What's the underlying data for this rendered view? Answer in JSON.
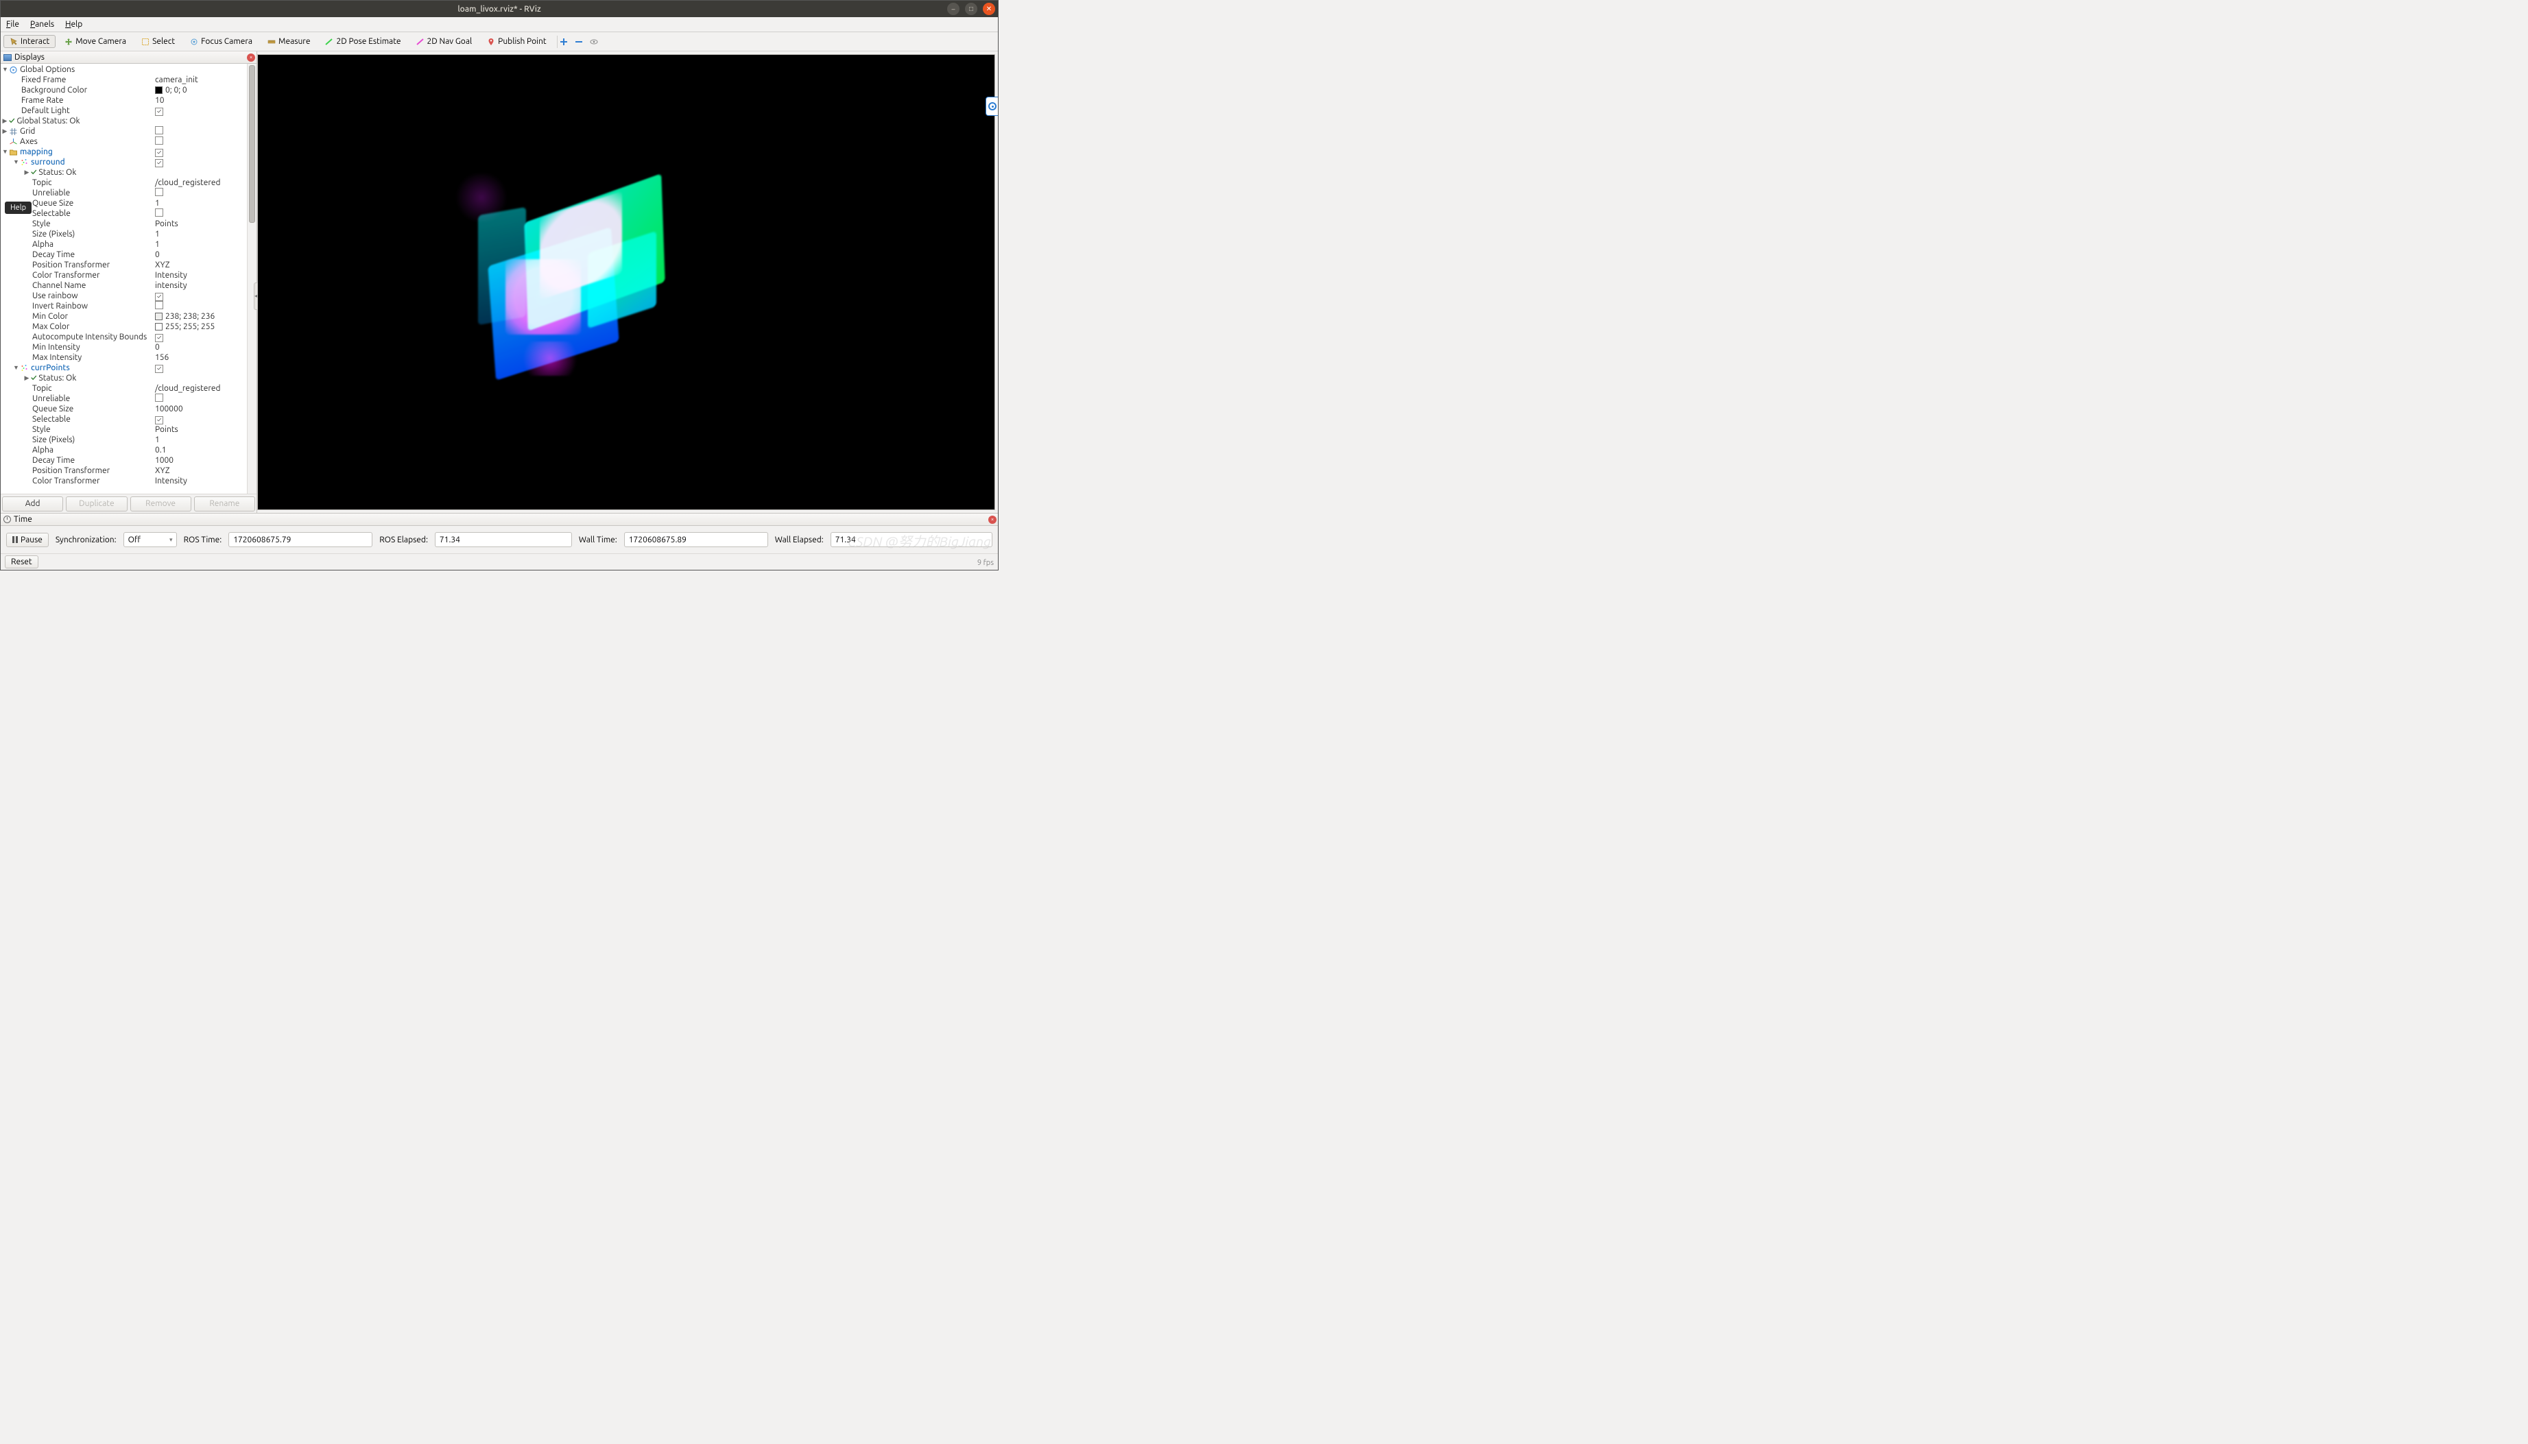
{
  "window": {
    "title": "loam_livox.rviz* - RViz",
    "help_tooltip": "Help"
  },
  "menubar": {
    "file": "File",
    "panels": "Panels",
    "help": "Help"
  },
  "toolbar": {
    "interact": "Interact",
    "move_camera": "Move Camera",
    "select": "Select",
    "focus_camera": "Focus Camera",
    "measure": "Measure",
    "pose_estimate": "2D Pose Estimate",
    "nav_goal": "2D Nav Goal",
    "publish_point": "Publish Point"
  },
  "displays": {
    "title": "Displays",
    "add": "Add",
    "duplicate": "Duplicate",
    "remove": "Remove",
    "rename": "Rename",
    "global_options": {
      "label": "Global Options",
      "fixed_frame": {
        "k": "Fixed Frame",
        "v": "camera_init"
      },
      "background_color": {
        "k": "Background Color",
        "v": "0; 0; 0"
      },
      "frame_rate": {
        "k": "Frame Rate",
        "v": "10"
      },
      "default_light": {
        "k": "Default Light",
        "v_on": true
      }
    },
    "global_status": {
      "k": "Global Status: Ok"
    },
    "grid": {
      "k": "Grid"
    },
    "axes": {
      "k": "Axes"
    },
    "mapping": {
      "label": "mapping",
      "surround": {
        "label": "surround",
        "status": "Status: Ok",
        "topic": {
          "k": "Topic",
          "v": "/cloud_registered"
        },
        "unreliable": {
          "k": "Unreliable",
          "v_on": false
        },
        "queue_size": {
          "k": "Queue Size",
          "v": "1"
        },
        "selectable": {
          "k": "Selectable",
          "v_on": false
        },
        "style": {
          "k": "Style",
          "v": "Points"
        },
        "size_pixels": {
          "k": "Size (Pixels)",
          "v": "1"
        },
        "alpha": {
          "k": "Alpha",
          "v": "1"
        },
        "decay_time": {
          "k": "Decay Time",
          "v": "0"
        },
        "pos_transformer": {
          "k": "Position Transformer",
          "v": "XYZ"
        },
        "color_transformer": {
          "k": "Color Transformer",
          "v": "Intensity"
        },
        "channel_name": {
          "k": "Channel Name",
          "v": "intensity"
        },
        "use_rainbow": {
          "k": "Use rainbow",
          "v_on": true
        },
        "invert_rainbow": {
          "k": "Invert Rainbow",
          "v_on": false
        },
        "min_color": {
          "k": "Min Color",
          "v": "238; 238; 236"
        },
        "max_color": {
          "k": "Max Color",
          "v": "255; 255; 255"
        },
        "autocompute": {
          "k": "Autocompute Intensity Bounds",
          "v_on": true
        },
        "min_intensity": {
          "k": "Min Intensity",
          "v": "0"
        },
        "max_intensity": {
          "k": "Max Intensity",
          "v": "156"
        }
      },
      "currpoints": {
        "label": "currPoints",
        "status": "Status: Ok",
        "topic": {
          "k": "Topic",
          "v": "/cloud_registered"
        },
        "unreliable": {
          "k": "Unreliable",
          "v_on": false
        },
        "queue_size": {
          "k": "Queue Size",
          "v": "100000"
        },
        "selectable": {
          "k": "Selectable",
          "v_on": true
        },
        "style": {
          "k": "Style",
          "v": "Points"
        },
        "size_pixels": {
          "k": "Size (Pixels)",
          "v": "1"
        },
        "alpha": {
          "k": "Alpha",
          "v": "0.1"
        },
        "decay_time": {
          "k": "Decay Time",
          "v": "1000"
        },
        "pos_transformer": {
          "k": "Position Transformer",
          "v": "XYZ"
        },
        "color_transformer": {
          "k": "Color Transformer",
          "v": "Intensity"
        }
      }
    }
  },
  "time": {
    "title": "Time",
    "pause": "Pause",
    "sync_label": "Synchronization:",
    "sync_value": "Off",
    "ros_time_label": "ROS Time:",
    "ros_time_value": "1720608675.79",
    "ros_elapsed_label": "ROS Elapsed:",
    "ros_elapsed_value": "71.34",
    "wall_time_label": "Wall Time:",
    "wall_time_value": "1720608675.89",
    "wall_elapsed_label": "Wall Elapsed:",
    "wall_elapsed_value": "71.34"
  },
  "statusbar": {
    "reset": "Reset",
    "fps": "9 fps"
  },
  "watermark": "CSDN @努力的BigJiang"
}
